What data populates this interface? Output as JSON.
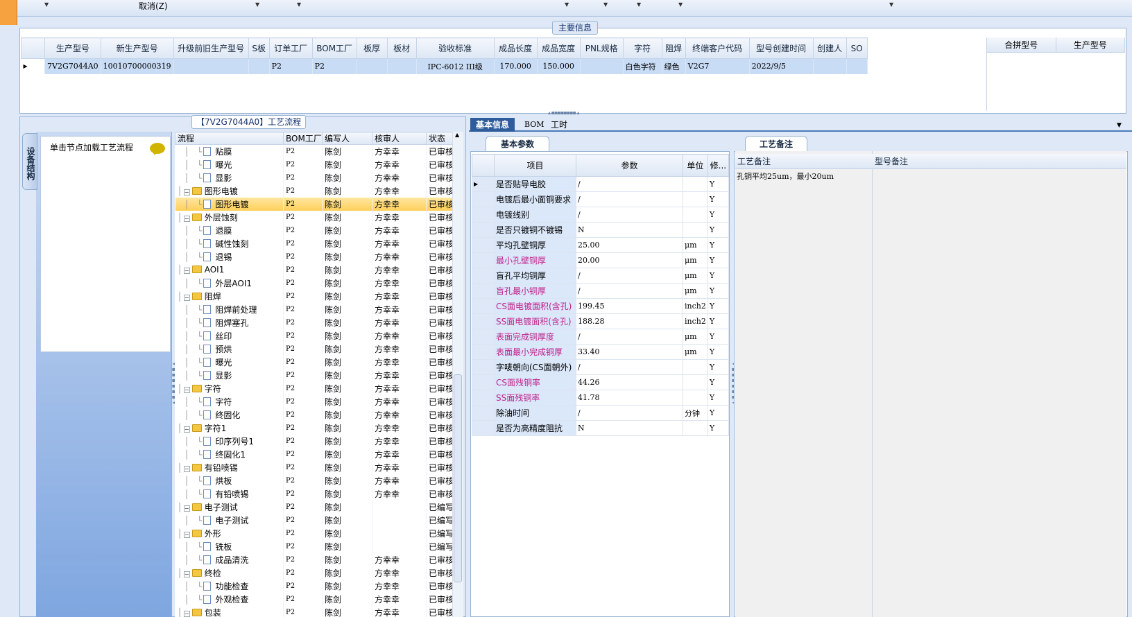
{
  "toolbar": {
    "cancel_label": "取消(Z)"
  },
  "main_info": {
    "title": "主要信息",
    "columns": [
      "生产型号",
      "新生产型号",
      "升级前旧生产型号",
      "S板",
      "订单工厂",
      "BOM工厂",
      "板厚",
      "板材",
      "验收标准",
      "成品长度",
      "成品宽度",
      "PNL规格",
      "字符",
      "阻焊",
      "终端客户代码",
      "型号创建时间",
      "创建人",
      "SO"
    ],
    "row": [
      "7V2G7044A0",
      "10010700000319",
      "",
      "",
      "P2",
      "P2",
      "",
      "",
      "IPC-6012 III级",
      "170.000",
      "150.000",
      "",
      "白色字符",
      "绿色",
      "V2G7",
      "2022/9/5",
      "",
      ""
    ],
    "merge_columns": [
      "合拼型号",
      "生产型号"
    ]
  },
  "process": {
    "title": "【7V2G7044A0】工艺流程",
    "side_tab": "设备结构",
    "load_hint": "单击节点加载工艺流程",
    "columns": [
      "流程",
      "BOM工厂",
      "编写人",
      "核审人",
      "状态"
    ],
    "rows": [
      {
        "name": "贴膜",
        "level": 2,
        "bom": "P2",
        "writer": "陈剑",
        "reviewer": "方幸幸",
        "status": "已审核"
      },
      {
        "name": "曝光",
        "level": 2,
        "bom": "P2",
        "writer": "陈剑",
        "reviewer": "方幸幸",
        "status": "已审核"
      },
      {
        "name": "显影",
        "level": 2,
        "bom": "P2",
        "writer": "陈剑",
        "reviewer": "方幸幸",
        "status": "已审核"
      },
      {
        "name": "图形电镀",
        "level": 1,
        "bom": "P2",
        "writer": "陈剑",
        "reviewer": "方幸幸",
        "status": "已审核"
      },
      {
        "name": "图形电镀",
        "level": 2,
        "bom": "P2",
        "writer": "陈剑",
        "reviewer": "方幸幸",
        "status": "已审核",
        "selected": true
      },
      {
        "name": "外层蚀刻",
        "level": 1,
        "bom": "P2",
        "writer": "陈剑",
        "reviewer": "方幸幸",
        "status": "已审核"
      },
      {
        "name": "退膜",
        "level": 2,
        "bom": "P2",
        "writer": "陈剑",
        "reviewer": "方幸幸",
        "status": "已审核"
      },
      {
        "name": "碱性蚀刻",
        "level": 2,
        "bom": "P2",
        "writer": "陈剑",
        "reviewer": "方幸幸",
        "status": "已审核"
      },
      {
        "name": "退锡",
        "level": 2,
        "bom": "P2",
        "writer": "陈剑",
        "reviewer": "方幸幸",
        "status": "已审核"
      },
      {
        "name": "AOI1",
        "level": 1,
        "bom": "P2",
        "writer": "陈剑",
        "reviewer": "方幸幸",
        "status": "已审核"
      },
      {
        "name": "外层AOI1",
        "level": 2,
        "bom": "P2",
        "writer": "陈剑",
        "reviewer": "方幸幸",
        "status": "已审核"
      },
      {
        "name": "阻焊",
        "level": 1,
        "bom": "P2",
        "writer": "陈剑",
        "reviewer": "方幸幸",
        "status": "已审核"
      },
      {
        "name": "阻焊前处理",
        "level": 2,
        "bom": "P2",
        "writer": "陈剑",
        "reviewer": "方幸幸",
        "status": "已审核"
      },
      {
        "name": "阻焊塞孔",
        "level": 2,
        "bom": "P2",
        "writer": "陈剑",
        "reviewer": "方幸幸",
        "status": "已审核"
      },
      {
        "name": "丝印",
        "level": 2,
        "bom": "P2",
        "writer": "陈剑",
        "reviewer": "方幸幸",
        "status": "已审核"
      },
      {
        "name": "预烘",
        "level": 2,
        "bom": "P2",
        "writer": "陈剑",
        "reviewer": "方幸幸",
        "status": "已审核"
      },
      {
        "name": "曝光",
        "level": 2,
        "bom": "P2",
        "writer": "陈剑",
        "reviewer": "方幸幸",
        "status": "已审核"
      },
      {
        "name": "显影",
        "level": 2,
        "bom": "P2",
        "writer": "陈剑",
        "reviewer": "方幸幸",
        "status": "已审核"
      },
      {
        "name": "字符",
        "level": 1,
        "bom": "P2",
        "writer": "陈剑",
        "reviewer": "方幸幸",
        "status": "已审核"
      },
      {
        "name": "字符",
        "level": 2,
        "bom": "P2",
        "writer": "陈剑",
        "reviewer": "方幸幸",
        "status": "已审核"
      },
      {
        "name": "终固化",
        "level": 2,
        "bom": "P2",
        "writer": "陈剑",
        "reviewer": "方幸幸",
        "status": "已审核"
      },
      {
        "name": "字符1",
        "level": 1,
        "bom": "P2",
        "writer": "陈剑",
        "reviewer": "方幸幸",
        "status": "已审核"
      },
      {
        "name": "印序列号1",
        "level": 2,
        "bom": "P2",
        "writer": "陈剑",
        "reviewer": "方幸幸",
        "status": "已审核"
      },
      {
        "name": "终固化1",
        "level": 2,
        "bom": "P2",
        "writer": "陈剑",
        "reviewer": "方幸幸",
        "status": "已审核"
      },
      {
        "name": "有铅喷锡",
        "level": 1,
        "bom": "P2",
        "writer": "陈剑",
        "reviewer": "方幸幸",
        "status": "已审核"
      },
      {
        "name": "烘板",
        "level": 2,
        "bom": "P2",
        "writer": "陈剑",
        "reviewer": "方幸幸",
        "status": "已审核"
      },
      {
        "name": "有铅喷锡",
        "level": 2,
        "bom": "P2",
        "writer": "陈剑",
        "reviewer": "方幸幸",
        "status": "已审核"
      },
      {
        "name": "电子测试",
        "level": 1,
        "bom": "P2",
        "writer": "陈剑",
        "reviewer": "",
        "status": "已编写"
      },
      {
        "name": "电子测试",
        "level": 2,
        "bom": "P2",
        "writer": "陈剑",
        "reviewer": "",
        "status": "已编写"
      },
      {
        "name": "外形",
        "level": 1,
        "bom": "P2",
        "writer": "陈剑",
        "reviewer": "",
        "status": "已编写"
      },
      {
        "name": "铣板",
        "level": 2,
        "bom": "P2",
        "writer": "陈剑",
        "reviewer": "",
        "status": "已编写"
      },
      {
        "name": "成品清洗",
        "level": 2,
        "bom": "P2",
        "writer": "陈剑",
        "reviewer": "方幸幸",
        "status": "已审核"
      },
      {
        "name": "终检",
        "level": 1,
        "bom": "P2",
        "writer": "陈剑",
        "reviewer": "方幸幸",
        "status": "已审核"
      },
      {
        "name": "功能检查",
        "level": 2,
        "bom": "P2",
        "writer": "陈剑",
        "reviewer": "方幸幸",
        "status": "已审核"
      },
      {
        "name": "外观检查",
        "level": 2,
        "bom": "P2",
        "writer": "陈剑",
        "reviewer": "方幸幸",
        "status": "已审核"
      },
      {
        "name": "包装",
        "level": 1,
        "bom": "P2",
        "writer": "陈剑",
        "reviewer": "方幸幸",
        "status": "已审核"
      }
    ]
  },
  "right_tabs": [
    "基本信息",
    "BOM",
    "工时"
  ],
  "basic_params": {
    "title": "基本参数",
    "columns": [
      "项目",
      "参数",
      "单位",
      "修..."
    ],
    "rows": [
      {
        "item": "是否贴导电胶",
        "value": "/",
        "unit": "",
        "mod": "Y",
        "pink": false
      },
      {
        "item": "电镀后最小面铜要求",
        "value": "/",
        "unit": "",
        "mod": "Y",
        "pink": false
      },
      {
        "item": "电镀线别",
        "value": "/",
        "unit": "",
        "mod": "Y",
        "pink": false
      },
      {
        "item": "是否只镀铜不镀锡",
        "value": "N",
        "unit": "",
        "mod": "Y",
        "pink": false
      },
      {
        "item": "平均孔壁铜厚",
        "value": "25.00",
        "unit": "μm",
        "mod": "Y",
        "pink": false
      },
      {
        "item": "最小孔壁铜厚",
        "value": "20.00",
        "unit": "μm",
        "mod": "Y",
        "pink": true
      },
      {
        "item": "盲孔平均铜厚",
        "value": "/",
        "unit": "μm",
        "mod": "Y",
        "pink": false
      },
      {
        "item": "盲孔最小铜厚",
        "value": "/",
        "unit": "μm",
        "mod": "Y",
        "pink": true
      },
      {
        "item": "CS面电镀面积(含孔)",
        "value": "199.45",
        "unit": "inch2",
        "mod": "Y",
        "pink": true
      },
      {
        "item": "SS面电镀面积(含孔)",
        "value": "188.28",
        "unit": "inch2",
        "mod": "Y",
        "pink": true
      },
      {
        "item": "表面完成铜厚度",
        "value": "/",
        "unit": "μm",
        "mod": "Y",
        "pink": true
      },
      {
        "item": "表面最小完成铜厚",
        "value": "33.40",
        "unit": "μm",
        "mod": "Y",
        "pink": true
      },
      {
        "item": "字唛朝向(CS面朝外)",
        "value": "/",
        "unit": "",
        "mod": "Y",
        "pink": false
      },
      {
        "item": "CS面残铜率",
        "value": "44.26",
        "unit": "",
        "mod": "Y",
        "pink": true
      },
      {
        "item": "SS面残铜率",
        "value": "41.78",
        "unit": "",
        "mod": "Y",
        "pink": true
      },
      {
        "item": "除油时间",
        "value": "/",
        "unit": "分钟",
        "mod": "Y",
        "pink": false
      },
      {
        "item": "是否为高精度阻抗",
        "value": "N",
        "unit": "",
        "mod": "Y",
        "pink": false
      }
    ]
  },
  "remarks": {
    "title": "工艺备注",
    "col1": "工艺备注",
    "col2": "型号备注",
    "text": "孔铜平均25um，最小20um"
  }
}
